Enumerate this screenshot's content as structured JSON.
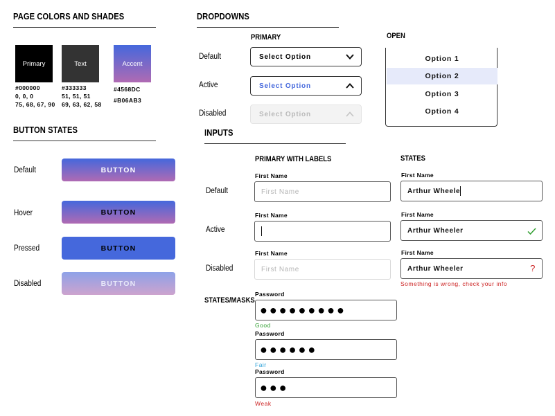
{
  "colors_section": {
    "title": "PAGE COLORS AND SHADES",
    "swatches": [
      {
        "label": "Primary",
        "hex": "#000000",
        "rgb": "0, 0, 0",
        "extra": "75, 68, 67, 90",
        "color": "#000000"
      },
      {
        "label": "Text",
        "hex": "#333333",
        "rgb": "51, 51, 51",
        "extra": "69, 63, 62, 58",
        "color": "#333333"
      },
      {
        "label": "Accent",
        "hex": "#4568DC",
        "hex2": "#B06AB3",
        "color_start": "#4568DC",
        "color_end": "#B06AB3"
      }
    ]
  },
  "buttons_section": {
    "title": "BUTTON STATES",
    "rows": [
      {
        "state": "Default",
        "label": "BUTTON"
      },
      {
        "state": "Hover",
        "label": "BUTTON"
      },
      {
        "state": "Pressed",
        "label": "BUTTON"
      },
      {
        "state": "Disabled",
        "label": "BUTTON"
      }
    ]
  },
  "dropdowns_section": {
    "title": "DROPDOWNS",
    "primary_heading": "PRIMARY",
    "open_heading": "OPEN",
    "rows": [
      {
        "state": "Default",
        "value": "Select Option"
      },
      {
        "state": "Active",
        "value": "Select Option"
      },
      {
        "state": "Disabled",
        "value": "Select Option"
      }
    ],
    "options": [
      "Option 1",
      "Option 2",
      "Option 3",
      "Option 4"
    ],
    "highlighted_option": "Option 2"
  },
  "inputs_section": {
    "title": "INPUTS",
    "primary_heading": "PRIMARY WITH LABELS",
    "states_heading": "STATES",
    "masks_heading": "STATES/MASKS",
    "rows": [
      {
        "state": "Default",
        "label": "First Name",
        "placeholder": "First Name",
        "state_label": "First Name",
        "state_value": "Arthur Wheele"
      },
      {
        "state": "Active",
        "label": "First Name",
        "placeholder": "",
        "state_label": "First Name",
        "state_value": "Arthur Wheeler"
      },
      {
        "state": "Disabled",
        "label": "First Name",
        "placeholder": "First Name",
        "state_label": "First Name",
        "state_value": "Arthur Wheeler"
      }
    ],
    "error_message": "Something is wrong, check your info",
    "passwords": [
      {
        "label": "Password",
        "mask": "●●●●●●●●●",
        "strength": "Good",
        "color": "#2e9d2e"
      },
      {
        "label": "Password",
        "mask": "●●●●●●",
        "strength": "Fair",
        "color": "#2aa0d8"
      },
      {
        "label": "Password",
        "mask": "●●●",
        "strength": "Weak",
        "color": "#cc2222"
      }
    ],
    "success_color": "#2e9d2e",
    "error_color": "#cc2222"
  }
}
